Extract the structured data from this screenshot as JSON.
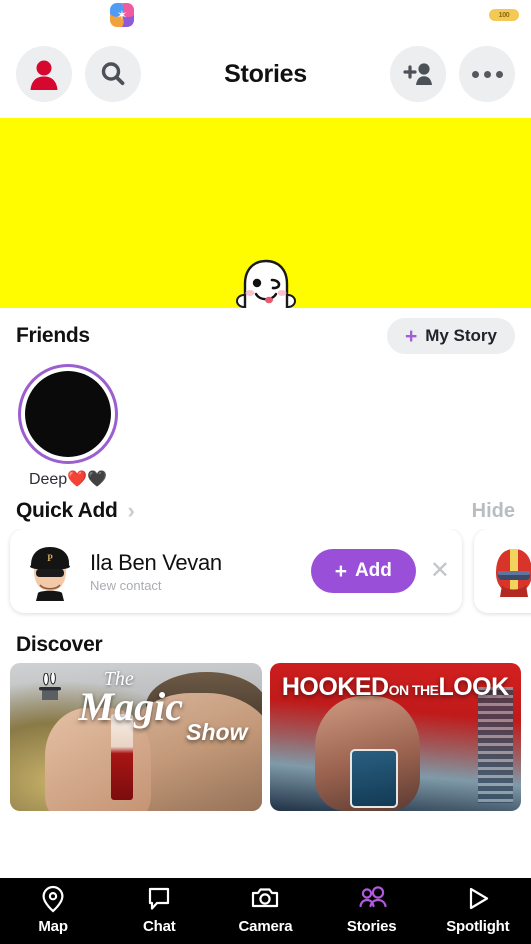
{
  "status_bar": {
    "app_icon_name": "app-icon-star",
    "battery_badge_text": "100"
  },
  "header": {
    "title": "Stories",
    "profile_icon": "profile-avatar-icon",
    "search_icon": "search-icon",
    "add_friend_icon": "add-friend-icon",
    "more_icon": "more-options-icon"
  },
  "banner": {
    "background_color": "#fffc00",
    "mascot": "snapchat-ghost-winking"
  },
  "friends": {
    "title": "Friends",
    "my_story": {
      "plus": "+",
      "label": "My Story"
    },
    "items": [
      {
        "name": "Deep❤️🖤",
        "ring_color": "#9b5fd0",
        "avatar_color": "#0a0a0a"
      }
    ]
  },
  "quick_add": {
    "title": "Quick Add",
    "chevron": "›",
    "hide_label": "Hide",
    "cards": [
      {
        "name": "Ila Ben Vevan",
        "subtitle": "New contact",
        "add_plus": "+",
        "add_label": "Add",
        "close": "✕",
        "avatar": "bitmoji-cap-sunglasses"
      },
      {
        "name": "",
        "subtitle": "",
        "avatar": "bitmoji-red-helmet"
      }
    ]
  },
  "discover": {
    "title": "Discover",
    "cards": [
      {
        "title_the": "The",
        "title_main": "Magic",
        "title_show": "Show",
        "theme_color": "#9e9288"
      },
      {
        "title_part1": "HOOKED",
        "title_part2": "ON THE",
        "title_part3": "LOOK",
        "theme_color": "#d32020"
      }
    ]
  },
  "bottom_nav": {
    "active_color": "#b15ae0",
    "items": [
      {
        "label": "Map",
        "icon": "map-pin-icon",
        "active": false
      },
      {
        "label": "Chat",
        "icon": "chat-bubble-icon",
        "active": false
      },
      {
        "label": "Camera",
        "icon": "camera-icon",
        "active": false
      },
      {
        "label": "Stories",
        "icon": "stories-people-icon",
        "active": true
      },
      {
        "label": "Spotlight",
        "icon": "play-triangle-icon",
        "active": false
      }
    ]
  }
}
